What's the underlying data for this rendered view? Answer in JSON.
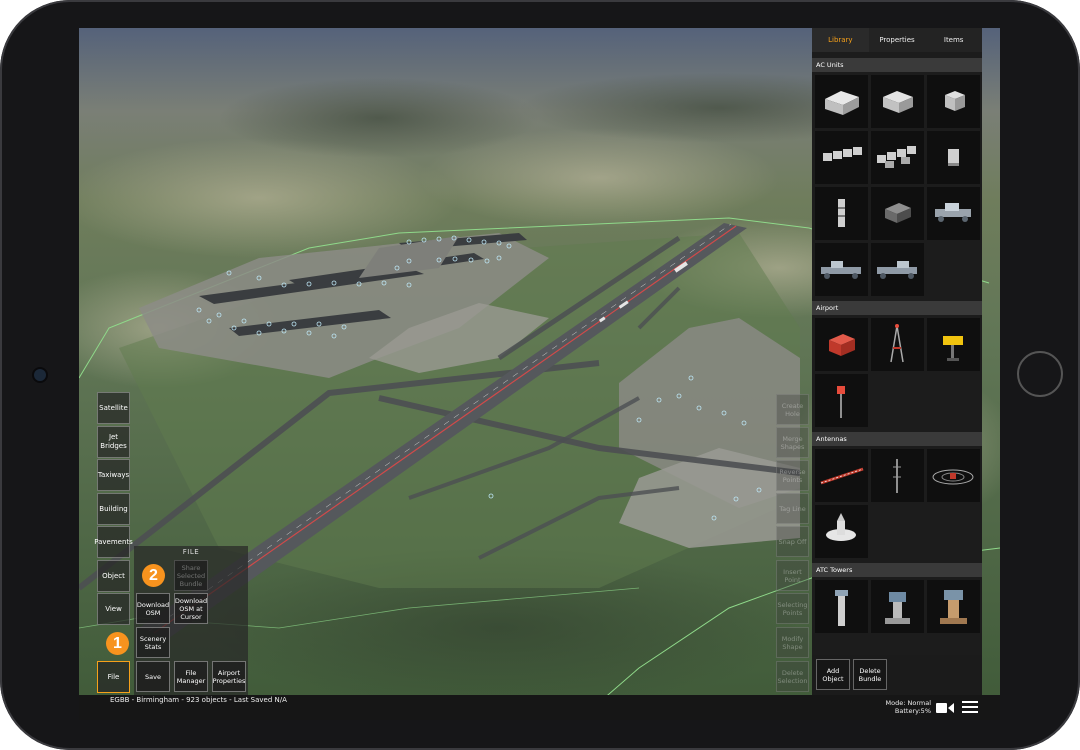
{
  "status": {
    "airport_summary": "EGBB - Birmingham - 923 objects - Last Saved N/A",
    "mode": "Mode: Normal",
    "battery": "Battery:5%"
  },
  "left_tools": [
    {
      "id": "satellite",
      "label": "Satellite"
    },
    {
      "id": "jet-bridges",
      "label": "Jet Bridges"
    },
    {
      "id": "taxiways",
      "label": "Taxiways"
    },
    {
      "id": "building",
      "label": "Building"
    },
    {
      "id": "pavements",
      "label": "Pavements"
    },
    {
      "id": "object",
      "label": "Object"
    },
    {
      "id": "view",
      "label": "View"
    },
    {
      "id": "file",
      "label": "File"
    }
  ],
  "file_menu": {
    "title": "FILE",
    "share_bundle": "Share Selected Bundle",
    "download_osm": "Download OSM",
    "download_osm_cursor": "Download OSM at Cursor",
    "scenery_stats": "Scenery Stats",
    "save": "Save",
    "file_manager": "File Manager",
    "airport_properties": "Airport Properties"
  },
  "badges": [
    "1",
    "2"
  ],
  "edit_tools": [
    "Create Hole",
    "Merge Shapes",
    "Reverse Points",
    "Tag Line",
    "Snap Off",
    "Insert Point",
    "Selecting Points",
    "Modify Shape",
    "Delete Selection"
  ],
  "panel": {
    "tabs": [
      "Library",
      "Properties",
      "Items"
    ],
    "active_tab": "Library",
    "sections": {
      "ac_units": "AC Units",
      "airport": "Airport",
      "antennas": "Antennas",
      "atc_towers": "ATC Towers"
    },
    "add_object": "Add Object",
    "delete_bundle": "Delete Bundle"
  },
  "colors": {
    "accent": "#f7a11a",
    "badge": "#f7931e",
    "panel_bg": "#1c1c1c",
    "boundary": "#8fd98a"
  },
  "icons": [
    "video-camera-icon",
    "hamburger-menu-icon"
  ]
}
